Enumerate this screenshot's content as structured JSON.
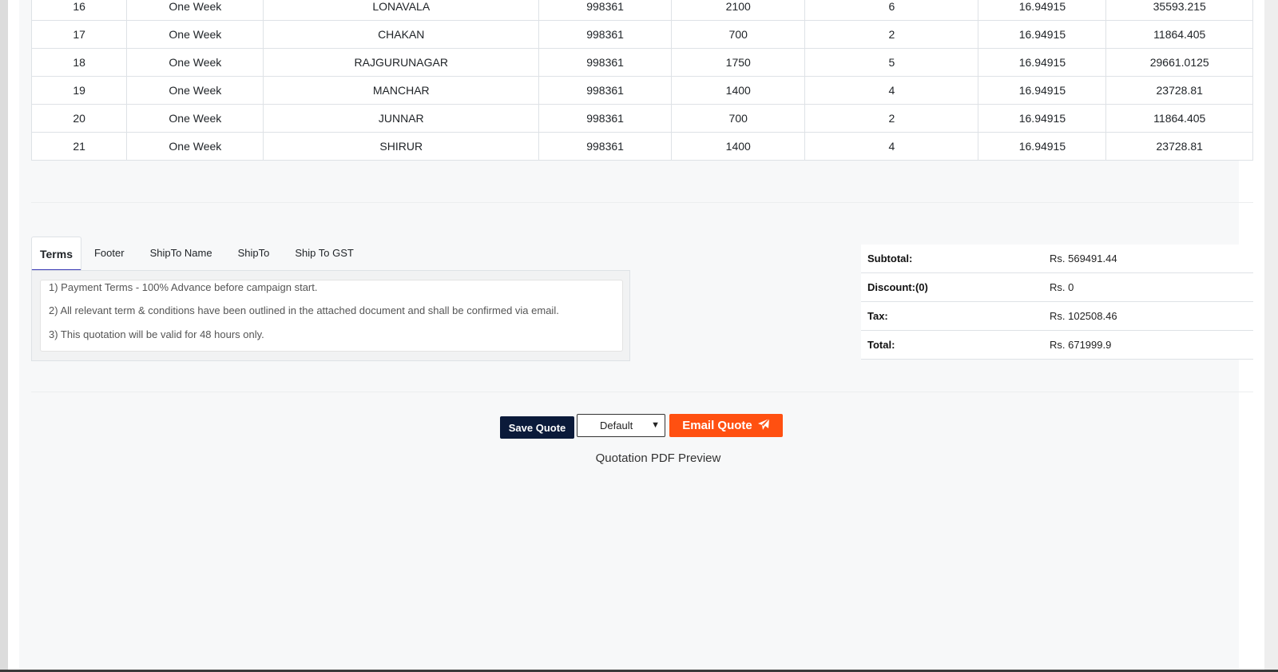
{
  "table": {
    "rows": [
      [
        "16",
        "One Week",
        "LONAVALA",
        "998361",
        "2100",
        "6",
        "16.94915",
        "35593.215"
      ],
      [
        "17",
        "One Week",
        "CHAKAN",
        "998361",
        "700",
        "2",
        "16.94915",
        "11864.405"
      ],
      [
        "18",
        "One Week",
        "RAJGURUNAGAR",
        "998361",
        "1750",
        "5",
        "16.94915",
        "29661.0125"
      ],
      [
        "19",
        "One Week",
        "MANCHAR",
        "998361",
        "1400",
        "4",
        "16.94915",
        "23728.81"
      ],
      [
        "20",
        "One Week",
        "JUNNAR",
        "998361",
        "700",
        "2",
        "16.94915",
        "11864.405"
      ],
      [
        "21",
        "One Week",
        "SHIRUR",
        "998361",
        "1400",
        "4",
        "16.94915",
        "23728.81"
      ]
    ]
  },
  "tabs": [
    {
      "label": "Terms"
    },
    {
      "label": "Footer"
    },
    {
      "label": "ShipTo Name"
    },
    {
      "label": "ShipTo"
    },
    {
      "label": "Ship To GST"
    }
  ],
  "terms": [
    "1) Payment Terms - 100% Advance before campaign start.",
    "2) All relevant term & conditions have been outlined in the attached document and shall be confirmed via email.",
    "3) This quotation will be valid for 48 hours only."
  ],
  "totals": {
    "subtotal": {
      "label": "Subtotal:",
      "value": "Rs. 569491.44"
    },
    "discount": {
      "label": "Discount:(0)",
      "value": "Rs. 0"
    },
    "tax": {
      "label": "Tax:",
      "value": "Rs. 102508.46"
    },
    "total": {
      "label": "Total:",
      "value": "Rs. 671999.9"
    }
  },
  "actions": {
    "save_label": "Save Quote",
    "template_selected": "Default",
    "email_label": "Email Quote",
    "email_icon": "paper-plane-icon",
    "pdf_preview_label": "Quotation PDF Preview"
  },
  "colors": {
    "save_bg": "#0b1a3a",
    "email_bg": "#ff5011",
    "tab_active_underline": "#3b3bb5"
  }
}
